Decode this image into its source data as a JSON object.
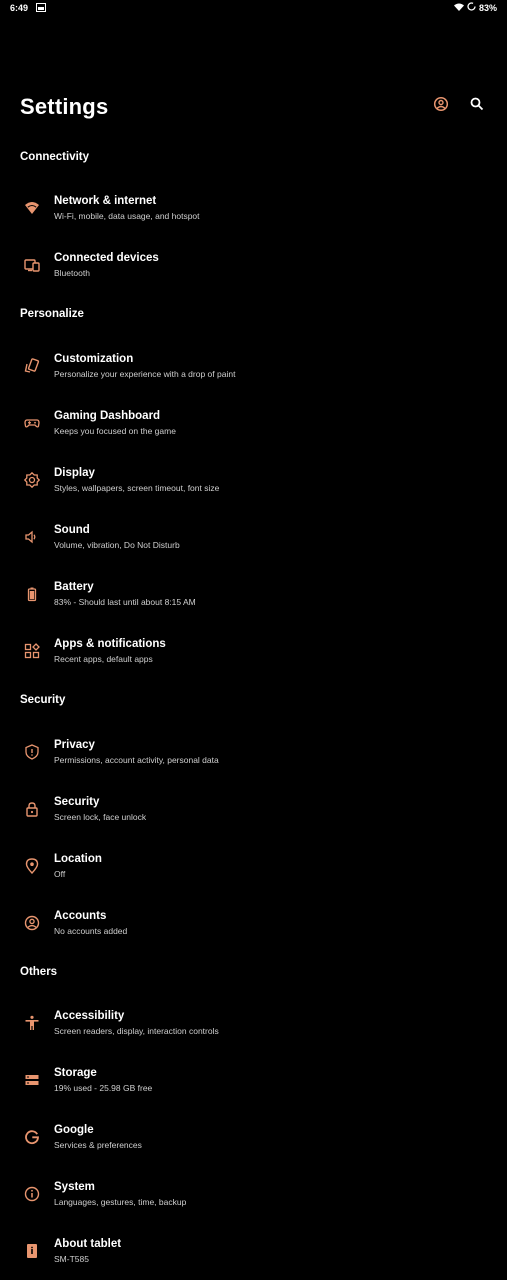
{
  "status_bar": {
    "time": "6:49",
    "battery": "83%"
  },
  "header": {
    "title": "Settings"
  },
  "accent_color": "#e8956f",
  "sections": {
    "connectivity": "Connectivity",
    "personalize": "Personalize",
    "security": "Security",
    "others": "Others"
  },
  "items": [
    {
      "label": "Network & internet",
      "sub": "Wi-Fi, mobile, data usage, and hotspot",
      "icon": "wifi-icon"
    },
    {
      "label": "Connected devices",
      "sub": "Bluetooth",
      "icon": "devices-icon"
    },
    {
      "label": "Customization",
      "sub": "Personalize your experience with a drop of paint",
      "icon": "palette-icon"
    },
    {
      "label": "Gaming Dashboard",
      "sub": "Keeps you focused on the game",
      "icon": "gamepad-icon"
    },
    {
      "label": "Display",
      "sub": "Styles, wallpapers, screen timeout, font size",
      "icon": "brightness-icon"
    },
    {
      "label": "Sound",
      "sub": "Volume, vibration, Do Not Disturb",
      "icon": "volume-icon"
    },
    {
      "label": "Battery",
      "sub": "83% - Should last until about 8:15 AM",
      "icon": "battery-icon"
    },
    {
      "label": "Apps & notifications",
      "sub": "Recent apps, default apps",
      "icon": "apps-icon"
    },
    {
      "label": "Privacy",
      "sub": "Permissions, account activity, personal data",
      "icon": "privacy-shield-icon"
    },
    {
      "label": "Security",
      "sub": "Screen lock, face unlock",
      "icon": "lock-icon"
    },
    {
      "label": "Location",
      "sub": "Off",
      "icon": "location-pin-icon"
    },
    {
      "label": "Accounts",
      "sub": "No accounts added",
      "icon": "account-circle-icon"
    },
    {
      "label": "Accessibility",
      "sub": "Screen readers, display, interaction controls",
      "icon": "accessibility-icon"
    },
    {
      "label": "Storage",
      "sub": "19% used - 25.98 GB free",
      "icon": "storage-icon"
    },
    {
      "label": "Google",
      "sub": "Services & preferences",
      "icon": "google-icon"
    },
    {
      "label": "System",
      "sub": "Languages, gestures, time, backup",
      "icon": "info-icon"
    },
    {
      "label": "About tablet",
      "sub": "SM-T585",
      "icon": "tablet-info-icon"
    }
  ]
}
